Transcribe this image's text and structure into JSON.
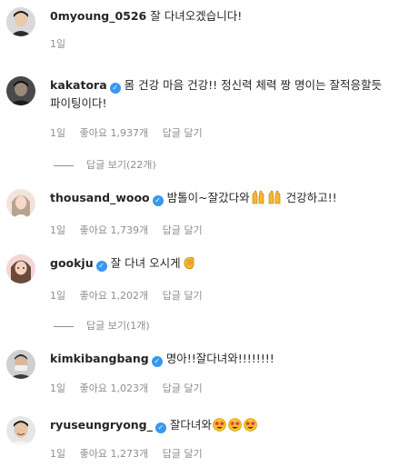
{
  "comments": [
    {
      "username": "0myoung_0526",
      "verified": false,
      "text": "잘 다녀오겠습니다!",
      "time": "1일",
      "likes": "",
      "reply": ""
    },
    {
      "username": "kakatora",
      "verified": true,
      "text": "몸 건강 마음 건강!! 정신력 체력 짱 명이는 잘적응할듯 파이팅이다!",
      "time": "1일",
      "likes": "좋아요 1,937개",
      "reply": "답글 달기",
      "view_replies": "답글 보기(22개)"
    },
    {
      "username": "thousand_wooo",
      "verified": true,
      "text_before": "밤톨이~잘갔다와",
      "text_after": " 건강하고!!",
      "emojis": [
        "raising-hands",
        "raising-hands"
      ],
      "time": "1일",
      "likes": "좋아요 1,739개",
      "reply": "답글 달기"
    },
    {
      "username": "gookju",
      "verified": true,
      "text": "잘 다녀 오시게",
      "emojis": [
        "clapping-hand"
      ],
      "time": "1일",
      "likes": "좋아요 1,202개",
      "reply": "답글 달기",
      "view_replies": "답글 보기(1개)"
    },
    {
      "username": "kimkibangbang",
      "verified": true,
      "text": "명아!!잘다녀와!!!!!!!!",
      "time": "1일",
      "likes": "좋아요 1,023개",
      "reply": "답글 달기"
    },
    {
      "username": "ryuseungryong_",
      "verified": true,
      "text": "잘다녀와",
      "emojis": [
        "star-struck",
        "star-struck",
        "star-struck"
      ],
      "time": "1일",
      "likes": "좋아요 1,273개",
      "reply": "답글 달기"
    }
  ],
  "colors": {
    "verified_badge": "#3897f0",
    "secondary_text": "#8e8e8e",
    "primary_text": "#262626"
  }
}
